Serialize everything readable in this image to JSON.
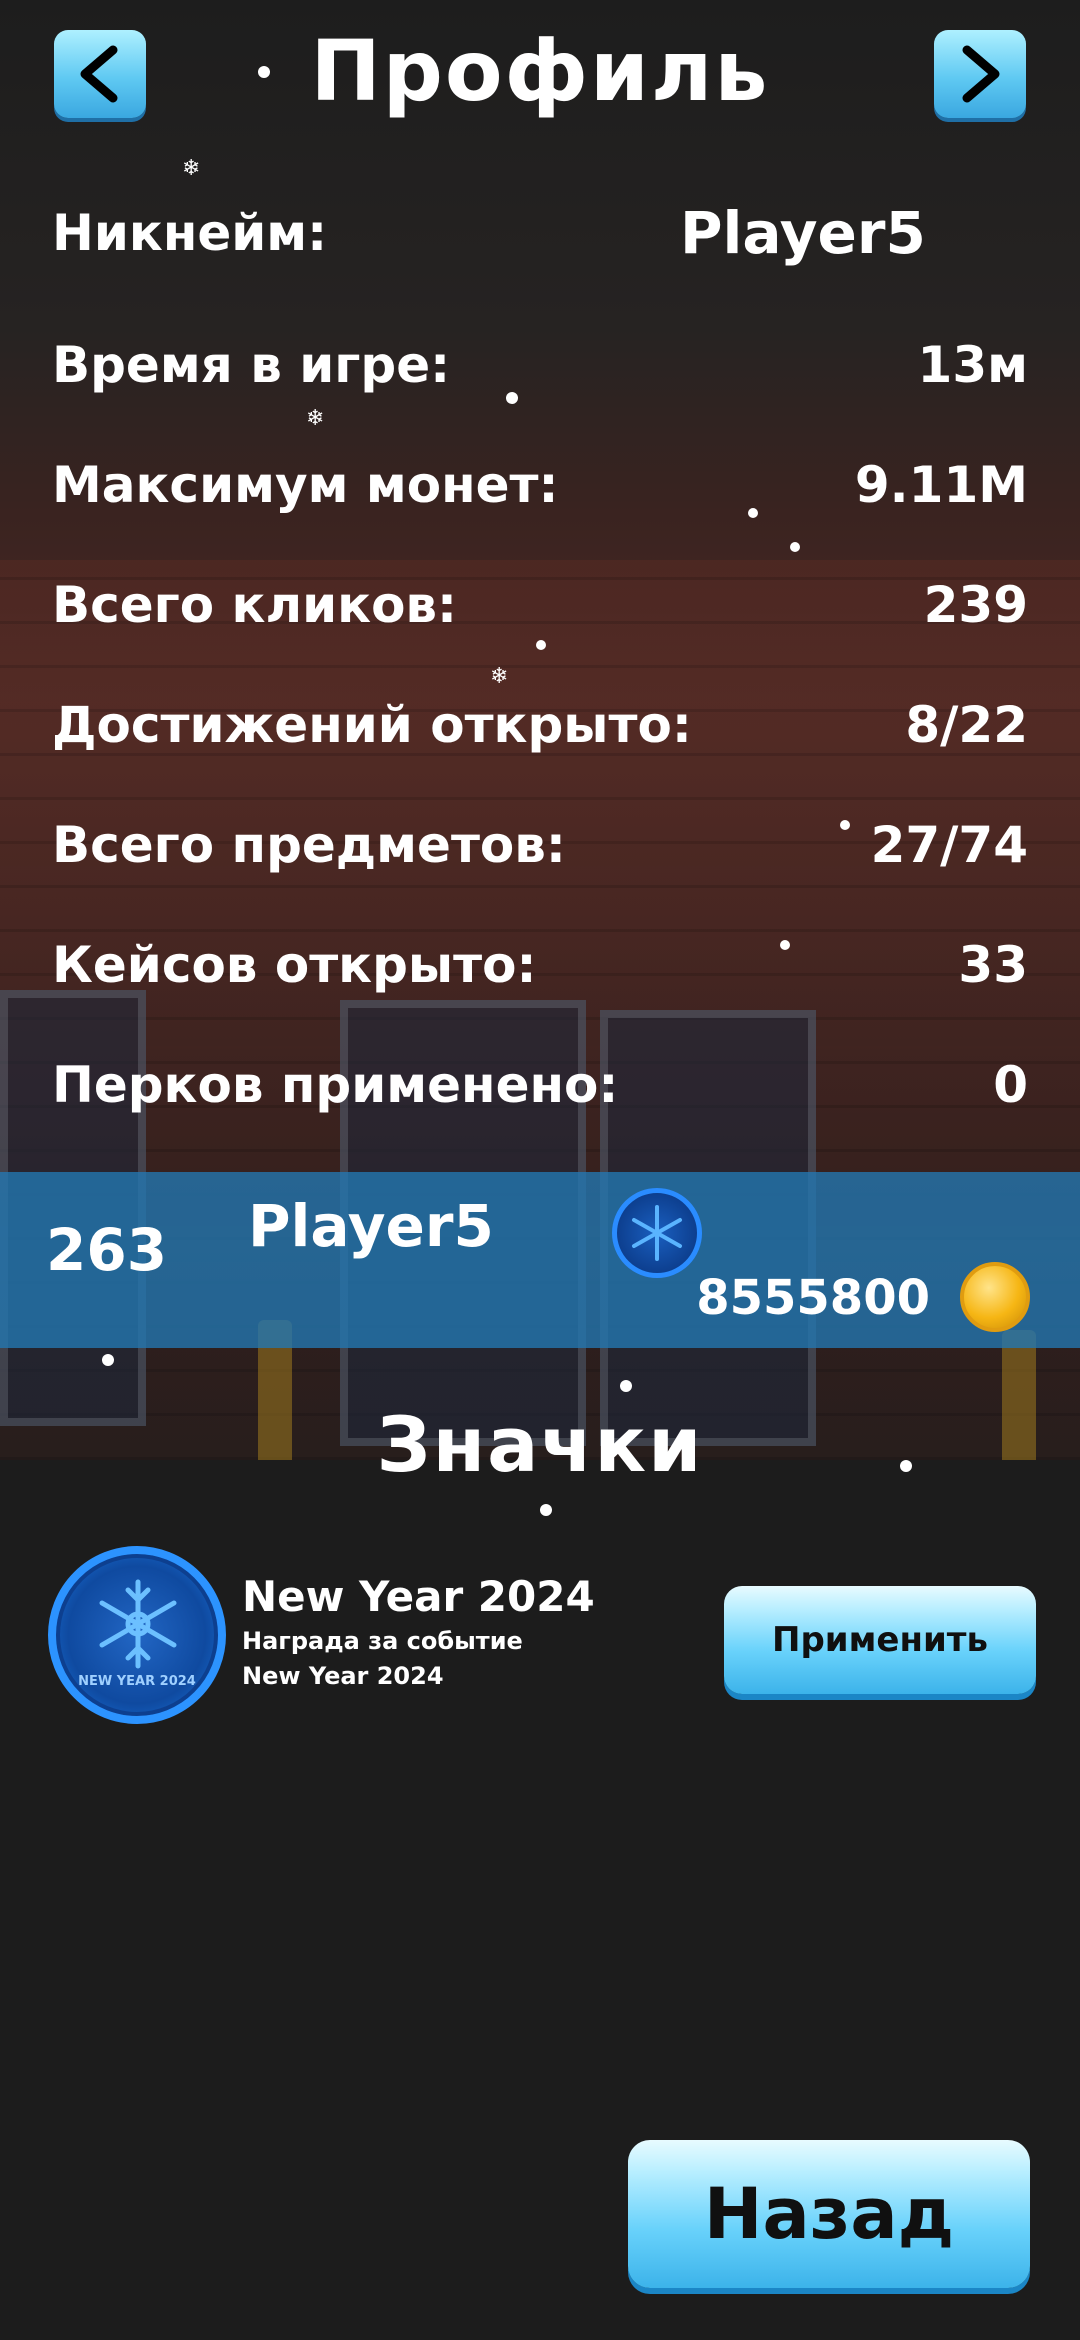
{
  "header": {
    "title": "Профиль"
  },
  "stats": [
    {
      "label": "Никнейм:",
      "value": "Player5"
    },
    {
      "label": "Время в игре:",
      "value": "13м"
    },
    {
      "label": "Максимум монет:",
      "value": "9.11M"
    },
    {
      "label": "Всего кликов:",
      "value": "239"
    },
    {
      "label": "Достижений открыто:",
      "value": "8/22"
    },
    {
      "label": "Всего предметов:",
      "value": "27/74"
    },
    {
      "label": "Кейсов открыто:",
      "value": "33"
    },
    {
      "label": "Перков применено:",
      "value": "0"
    }
  ],
  "player_bar": {
    "rank": "263",
    "name": "Player5",
    "coins": "8555800"
  },
  "badges_section": {
    "title": "Значки",
    "items": [
      {
        "name": "New Year 2024",
        "description": "Награда за событие New Year 2024",
        "badge_caption": "NEW YEAR 2024",
        "apply_label": "Применить"
      }
    ]
  },
  "footer": {
    "back_label": "Назад"
  },
  "colors": {
    "accent_blue": "#5fc9f2",
    "bar_blue": "#2278b4",
    "badge_blue": "#2c93ff",
    "coin_gold": "#f6b614"
  },
  "icons": [
    "arrow-left-icon",
    "arrow-right-icon",
    "snowflake-badge-icon",
    "coin-icon"
  ]
}
